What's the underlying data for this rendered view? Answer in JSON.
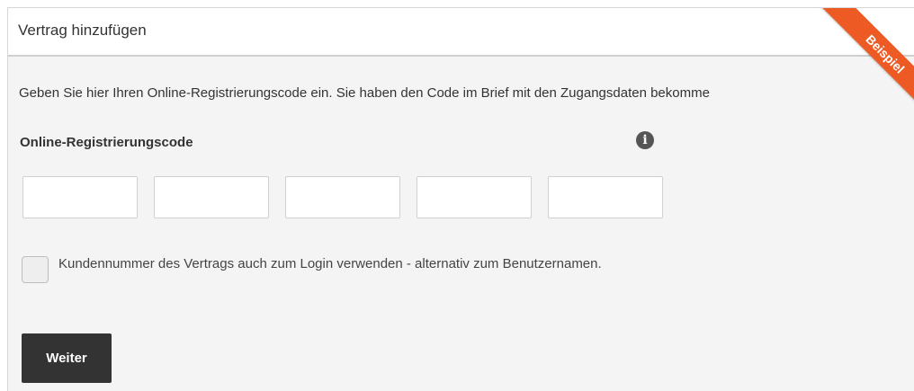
{
  "header": {
    "title": "Vertrag hinzufügen",
    "ribbon": "Beispiel",
    "ribbon_color": "#ee5a24"
  },
  "main": {
    "intro": "Geben Sie hier Ihren Online-Registrierungscode ein. Sie haben den Code im Brief mit den Zugangsdaten bekomme",
    "code_label": "Online-Registrierungscode",
    "info_icon": "i",
    "code_fields": [
      {
        "value": "",
        "placeholder": ""
      },
      {
        "value": "",
        "placeholder": ""
      },
      {
        "value": "",
        "placeholder": ""
      },
      {
        "value": "",
        "placeholder": ""
      },
      {
        "value": "",
        "placeholder": ""
      }
    ],
    "checkbox": {
      "checked": false,
      "label": "Kundennummer des Vertrags auch zum Login verwenden - alternativ zum Benutzernamen."
    },
    "submit_label": "Weiter"
  },
  "colors": {
    "panel_background": "#f4f4f4",
    "button_background": "#333333",
    "accent": "#ee5a24"
  }
}
